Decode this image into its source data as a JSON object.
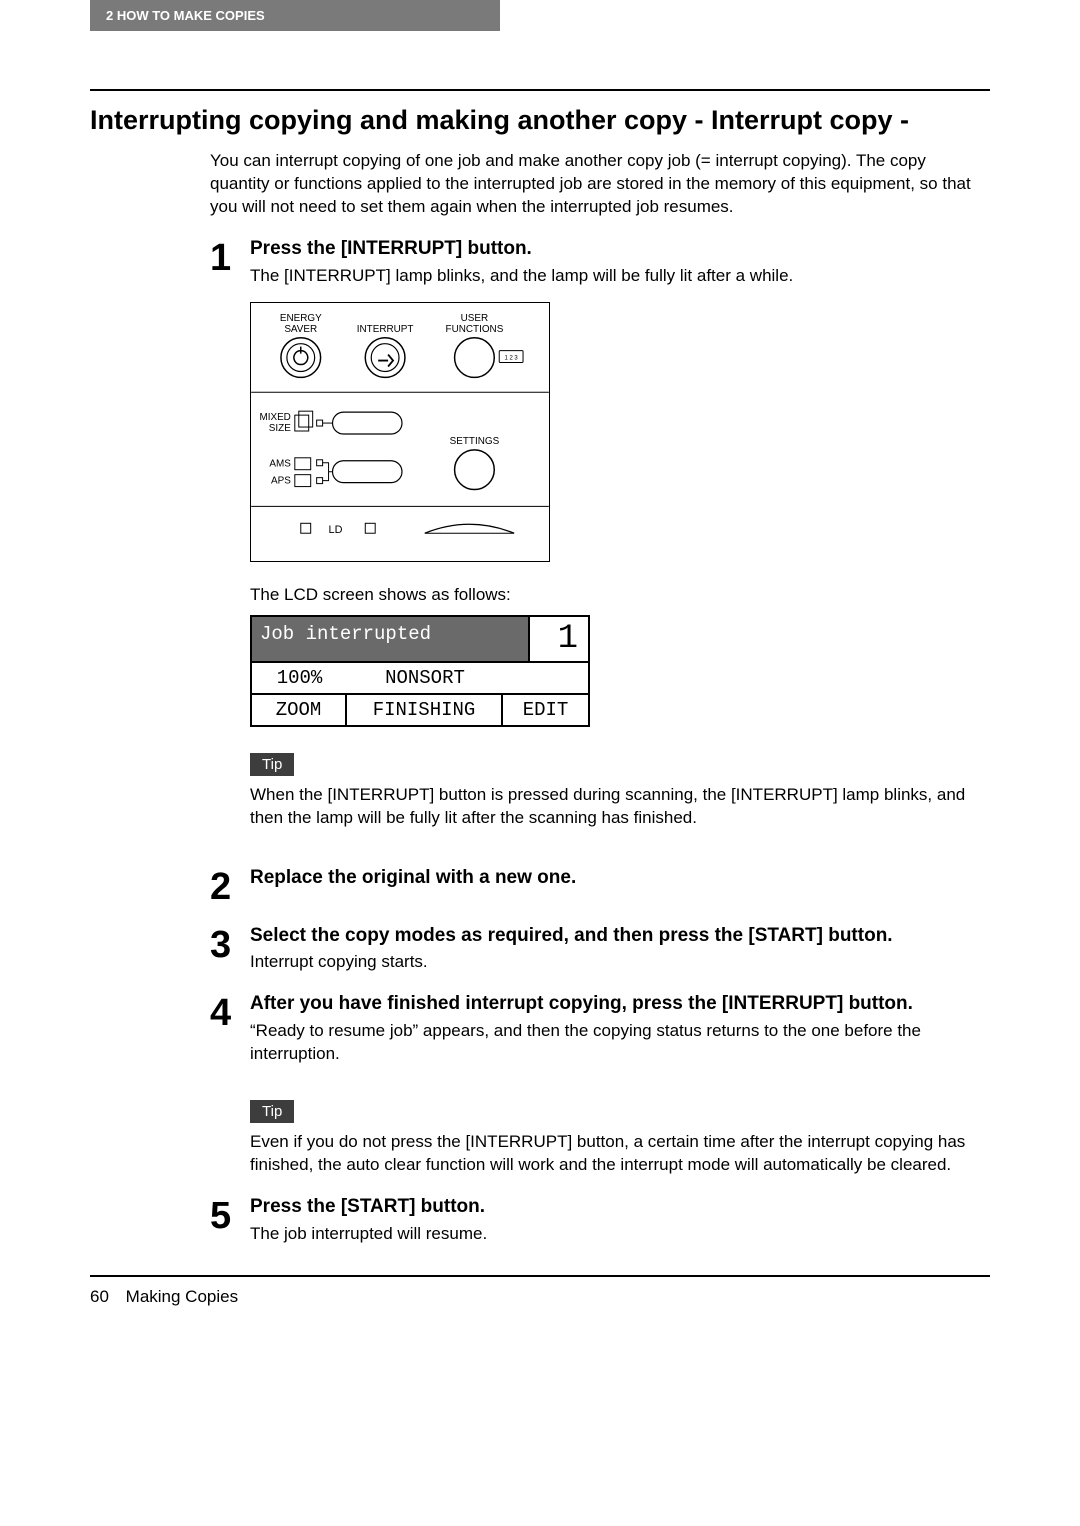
{
  "header": {
    "tab": "2   HOW TO MAKE COPIES"
  },
  "title": "Interrupting copying and making another copy - Interrupt copy -",
  "intro": "You can interrupt copying of one job and make another copy job (= interrupt copying). The copy quantity or functions applied to the interrupted job are stored in the memory of this equipment, so that you will not need to set them again when the interrupted job resumes.",
  "steps": {
    "s1": {
      "num": "1",
      "title": "Press the [INTERRUPT] button.",
      "desc": "The [INTERRUPT] lamp blinks, and the lamp will be fully lit after a while."
    },
    "s2": {
      "num": "2",
      "title": "Replace the original with a new one."
    },
    "s3": {
      "num": "3",
      "title": "Select the copy modes as required, and then press the [START] button.",
      "desc": "Interrupt copying starts."
    },
    "s4": {
      "num": "4",
      "title": "After you have finished interrupt copying, press the [INTERRUPT] button.",
      "desc": "“Ready to resume job” appears, and then the copying status returns to the one before the interruption."
    },
    "s5": {
      "num": "5",
      "title": "Press the [START] button.",
      "desc": "The job interrupted will resume."
    }
  },
  "panel": {
    "energy_saver": "ENERGY\nSAVER",
    "interrupt": "INTERRUPT",
    "user_functions": "USER\nFUNCTIONS",
    "mixed_size": "MIXED\nSIZE",
    "ams": "AMS",
    "aps": "APS",
    "settings": "SETTINGS",
    "ld": "LD",
    "digits": "1 2 3"
  },
  "lcd_caption": "The LCD screen shows as follows:",
  "lcd": {
    "message": "Job interrupted",
    "count": "1",
    "ratio": "100%",
    "sort": "NONSORT",
    "zoom": "ZOOM",
    "finishing": "FINISHING",
    "edit": "EDIT"
  },
  "tips": {
    "label": "Tip",
    "tip1": "When the [INTERRUPT] button is pressed during scanning, the [INTERRUPT] lamp blinks, and then the lamp will be fully lit after the scanning has finished.",
    "tip2": "Even if you do not press the [INTERRUPT] button, a certain time after the interrupt copying has finished, the auto clear function will work and the interrupt mode will automatically be cleared."
  },
  "footer": {
    "page": "60",
    "section": "Making Copies"
  }
}
